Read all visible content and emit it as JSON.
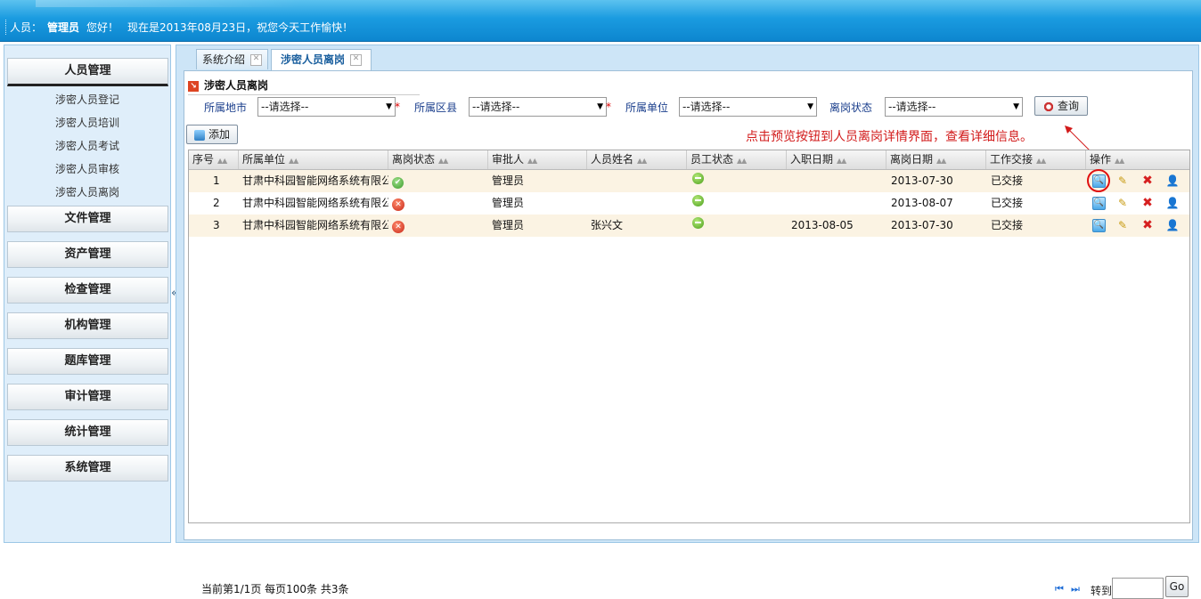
{
  "header": {
    "user_label": "人员：",
    "user_name": "管理员",
    "greeting": "您好！",
    "date_message": "现在是2013年08月23日，祝您今天工作愉快！"
  },
  "sidebar": {
    "menus": [
      {
        "label": "人员管理",
        "active": true,
        "items": [
          "涉密人员登记",
          "涉密人员培训",
          "涉密人员考试",
          "涉密人员审核",
          "涉密人员离岗"
        ]
      },
      {
        "label": "文件管理"
      },
      {
        "label": "资产管理"
      },
      {
        "label": "检查管理"
      },
      {
        "label": "机构管理"
      },
      {
        "label": "题库管理"
      },
      {
        "label": "审计管理"
      },
      {
        "label": "统计管理"
      },
      {
        "label": "系统管理"
      }
    ],
    "collapse_glyph": "«"
  },
  "tabs": [
    {
      "label": "系统介绍",
      "active": false
    },
    {
      "label": "涉密人员离岗",
      "active": true
    }
  ],
  "search": {
    "title": "涉密人员离岗",
    "filters": [
      {
        "label": "所属地市",
        "value": "--请选择--",
        "required": true
      },
      {
        "label": "所属区县",
        "value": "--请选择--",
        "required": true
      },
      {
        "label": "所属单位",
        "value": "--请选择--",
        "required": false
      },
      {
        "label": "离岗状态",
        "value": "--请选择--",
        "required": false
      }
    ],
    "required_mark": "*",
    "query_label": "查询"
  },
  "toolbar": {
    "add_label": "添加",
    "annotation": "点击预览按钮到人员离岗详情界面，查看详细信息。"
  },
  "table": {
    "columns": [
      "序号",
      "所属单位",
      "离岗状态",
      "审批人",
      "人员姓名",
      "员工状态",
      "入职日期",
      "离岗日期",
      "工作交接",
      "操作"
    ],
    "rows": [
      {
        "no": "1",
        "unit": "甘肃中科园智能网络系统有限公司",
        "leave_status": "approved",
        "approver": "管理员",
        "name": "",
        "emp_status": "minus",
        "join_date": "",
        "leave_date": "2013-07-30",
        "handover": "已交接"
      },
      {
        "no": "2",
        "unit": "甘肃中科园智能网络系统有限公司",
        "leave_status": "rejected",
        "approver": "管理员",
        "name": "",
        "emp_status": "minus",
        "join_date": "",
        "leave_date": "2013-08-07",
        "handover": "已交接"
      },
      {
        "no": "3",
        "unit": "甘肃中科园智能网络系统有限公司",
        "leave_status": "rejected",
        "approver": "管理员",
        "name": "张兴文",
        "emp_status": "minus",
        "join_date": "2013-08-05",
        "leave_date": "2013-07-30",
        "handover": "已交接"
      }
    ],
    "row_actions": [
      "preview-icon",
      "edit-icon",
      "delete-icon",
      "user-icon"
    ]
  },
  "pager": {
    "summary": "当前第1/1页  每页100条  共3条",
    "first_glyph": "⏮",
    "last_glyph": "⏭",
    "goto_label": "转到",
    "goto_value": "",
    "go_label": "Go"
  },
  "colors": {
    "header_blue": "#1a9be0",
    "annotation_red": "#d21a1a",
    "row_alt": "#fbf3e3"
  }
}
